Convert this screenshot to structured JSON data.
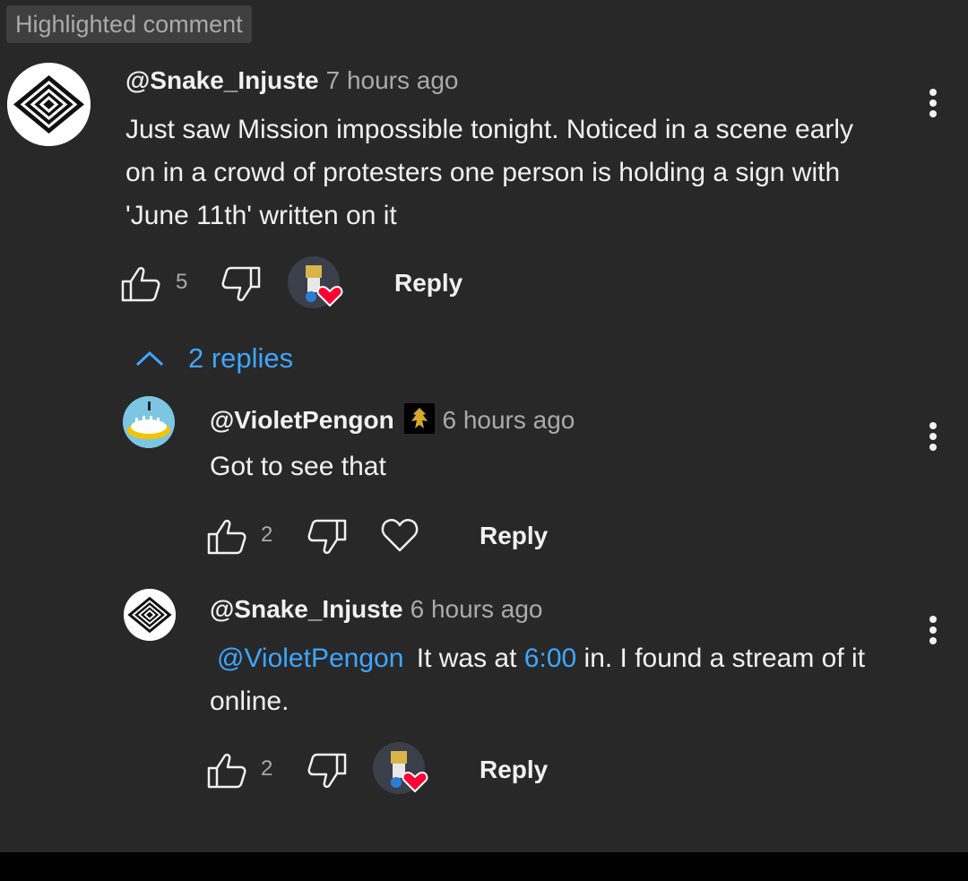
{
  "badge": "Highlighted comment",
  "comment": {
    "author": "@Snake_Injuste",
    "time": "7 hours ago",
    "text": "Just saw Mission impossible tonight. Noticed in a scene early on in a crowd of protesters one person is holding a sign with 'June 11th' written on it",
    "likes": "5",
    "reply_label": "Reply",
    "avatar_icon": "maze-logo-icon"
  },
  "replies_toggle": "2 replies",
  "replies": [
    {
      "author": "@VioletPengon",
      "time": "6 hours ago",
      "text": "Got to see that",
      "likes": "2",
      "reply_label": "Reply"
    },
    {
      "author": "@Snake_Injuste",
      "time": "6 hours ago",
      "mention": "@VioletPengon",
      "text_part1": "It was at",
      "timestamp_link": "6:00",
      "text_part2": "in. I found a stream of it online.",
      "likes": "2",
      "reply_label": "Reply"
    }
  ],
  "colors": {
    "background": "#282828",
    "link": "#3ea6ff",
    "heart": "#ff0033",
    "secondary_text": "#aaaaaa"
  }
}
